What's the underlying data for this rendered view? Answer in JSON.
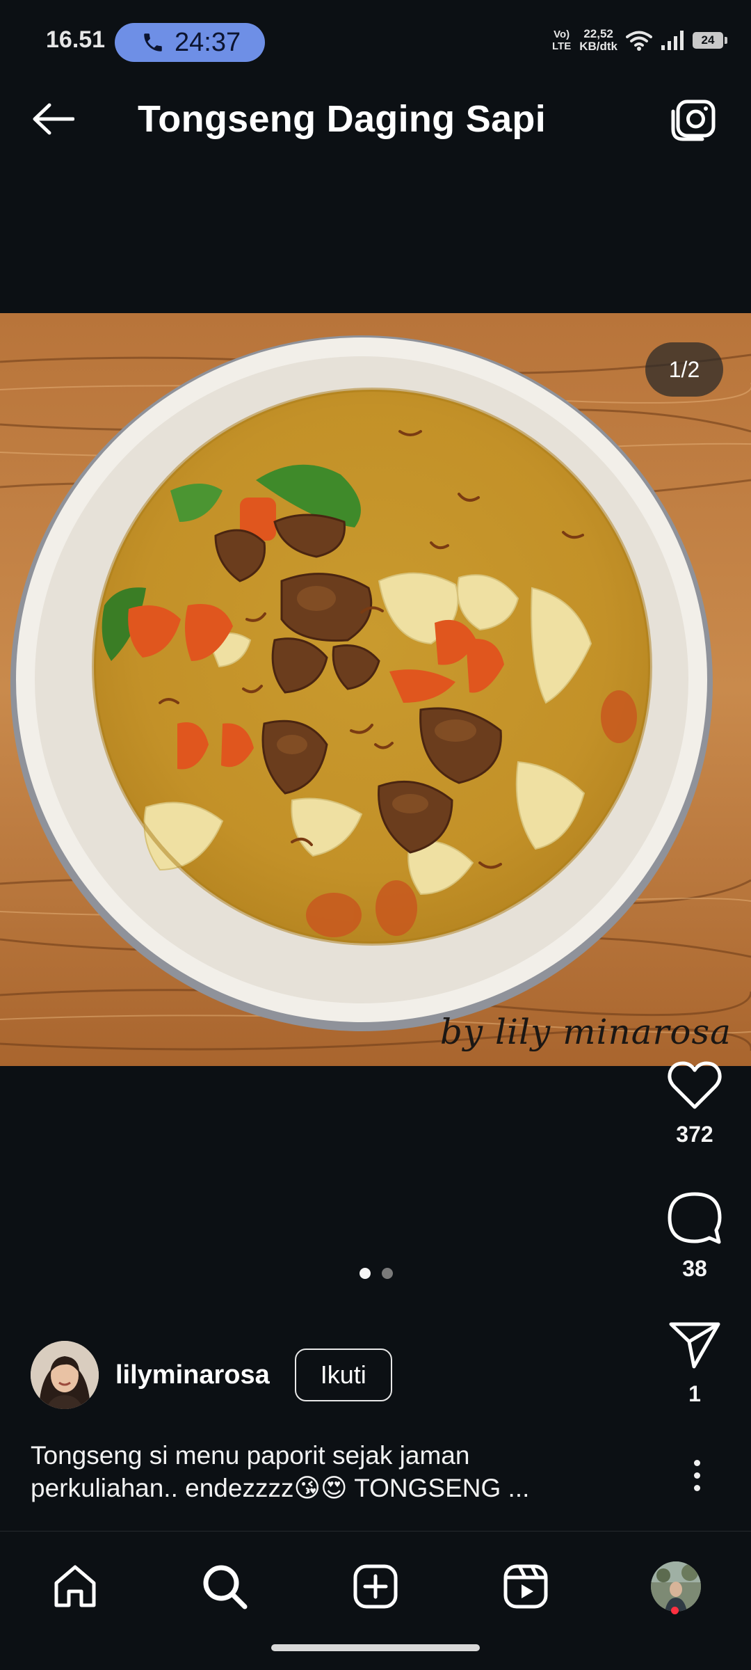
{
  "status_bar": {
    "time": "16.51",
    "call_duration": "24:37",
    "volte_line1": "Vo)",
    "volte_line2": "LTE",
    "net_speed_value": "22,52",
    "net_speed_unit": "KB/dtk",
    "battery_level": "24"
  },
  "header": {
    "title": "Tongseng Daging Sapi"
  },
  "post": {
    "image_counter": "1/2",
    "watermark": "by lily minarosa",
    "carousel_pages": 2,
    "carousel_active_index": 0,
    "likes": "372",
    "comments": "38",
    "shares": "1",
    "author": {
      "username": "lilyminarosa",
      "follow_label": "Ikuti"
    },
    "caption_line1": "Tongseng si menu paporit sejak jaman",
    "caption_line2": "perkuliahan.. endezzzz😘😍 TONGSENG ..."
  },
  "bottom_nav": {
    "items": [
      "home-icon",
      "search-icon",
      "create-icon",
      "reels-icon",
      "profile-avatar"
    ],
    "has_notification_dot": true
  },
  "colors": {
    "background": "#0c1014",
    "call_pill": "#6e8fe6",
    "notification_dot": "#ff3040"
  }
}
